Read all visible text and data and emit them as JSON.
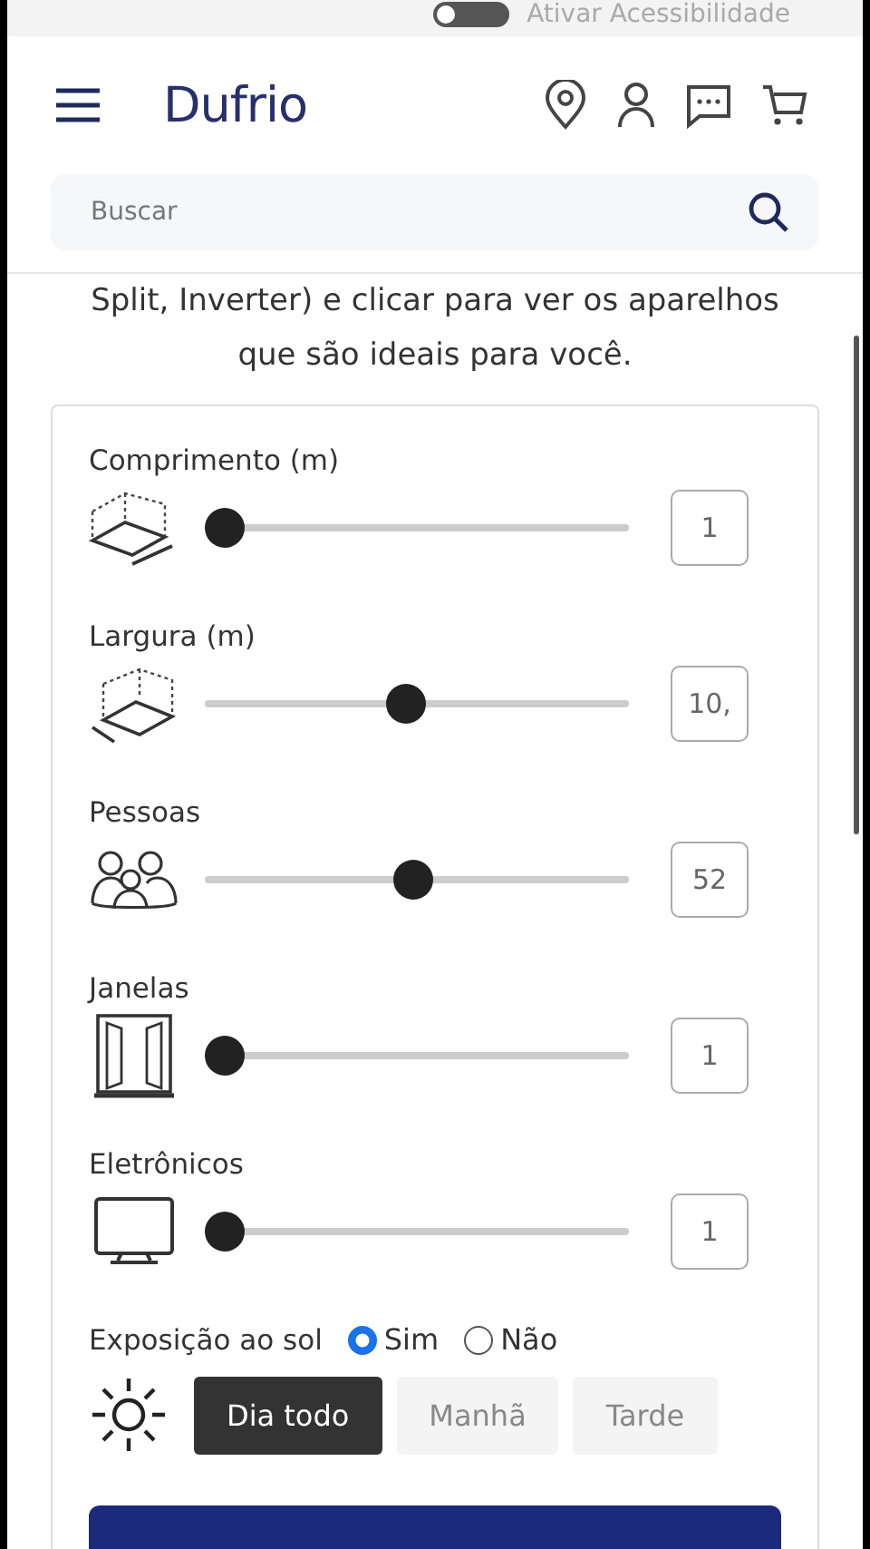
{
  "accessibility": {
    "label": "Ativar Acessibilidade",
    "on": false
  },
  "header": {
    "logo": "Dufrio"
  },
  "search": {
    "placeholder": "Buscar"
  },
  "intro": "Split, Inverter) e clicar para ver os aparelhos que são ideais para você.",
  "sliders": [
    {
      "label": "Comprimento (m)",
      "kind": "length",
      "level": 0,
      "value": "1"
    },
    {
      "label": "Largura (m)",
      "kind": "width",
      "level": 0.47,
      "value": "10,"
    },
    {
      "label": "Pessoas",
      "kind": "people",
      "level": 0.49,
      "value": "52"
    },
    {
      "label": "Janelas",
      "kind": "window",
      "level": 0,
      "value": "1"
    },
    {
      "label": "Eletrônicos",
      "kind": "tv",
      "level": 0,
      "value": "1"
    }
  ],
  "sun": {
    "label": "Exposição ao sol",
    "options": [
      {
        "label": "Sim",
        "selected": true
      },
      {
        "label": "Não",
        "selected": false
      }
    ],
    "periods": [
      {
        "label": "Dia todo",
        "selected": true
      },
      {
        "label": "Manhã",
        "selected": false
      },
      {
        "label": "Tarde",
        "selected": false
      }
    ]
  }
}
